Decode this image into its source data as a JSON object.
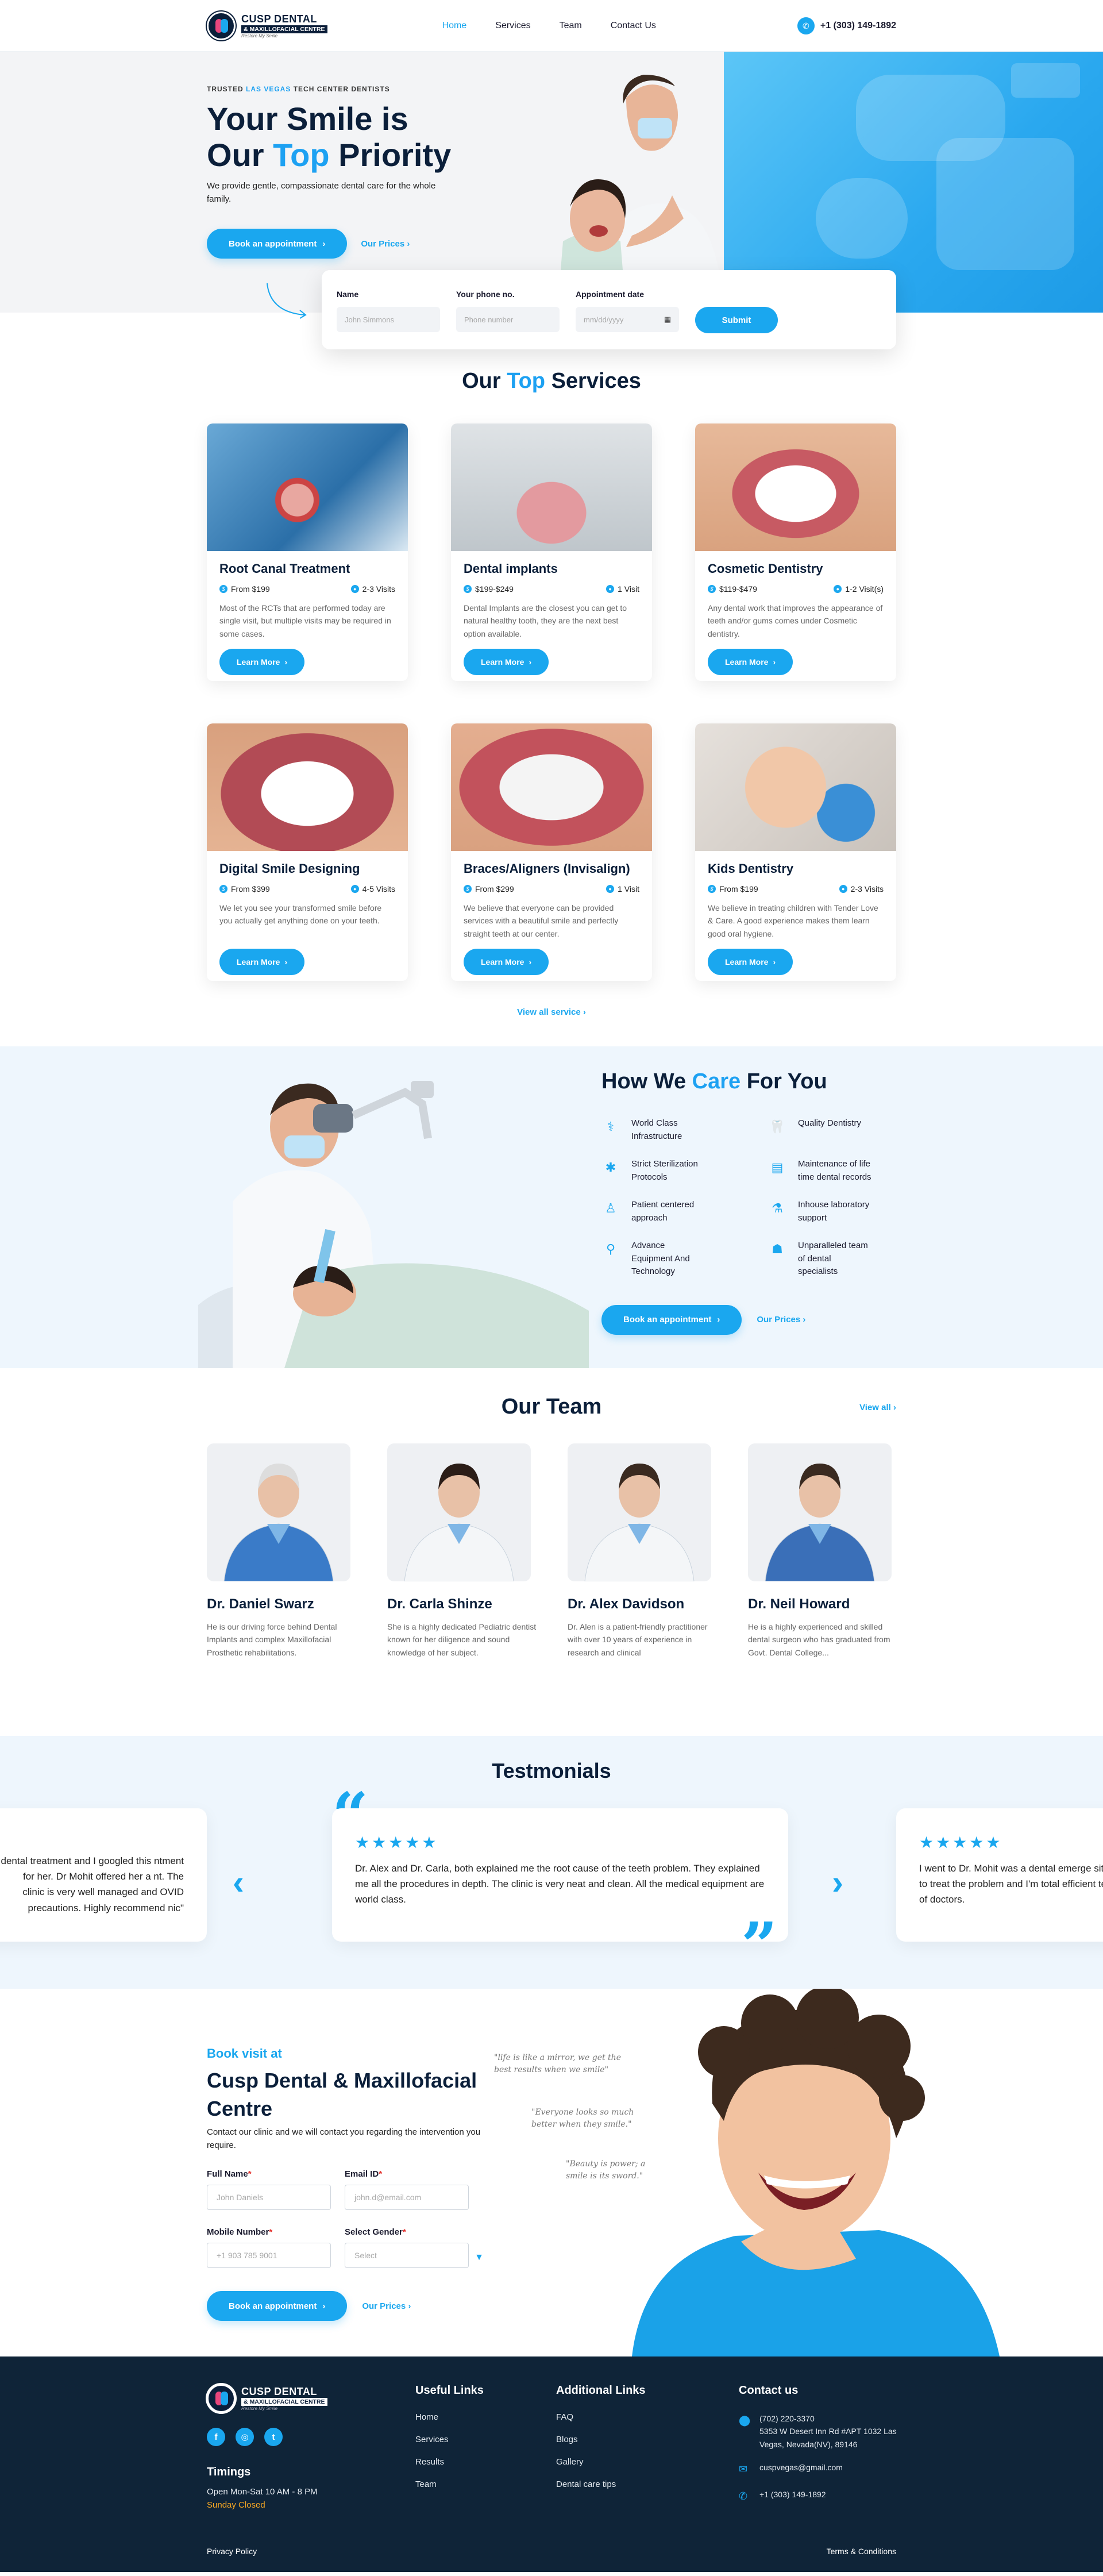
{
  "header": {
    "logo": {
      "line1": "CUSP DENTAL",
      "line2": "& MAXILLOFACIAL CENTRE",
      "line3": "Restore My Smile"
    },
    "nav": [
      "Home",
      "Services",
      "Team",
      "Contact Us"
    ],
    "phone": "+1 (303) 149-1892"
  },
  "hero": {
    "tag_pre": "TRUSTED ",
    "tag_highlight": "LAS VEGAS",
    "tag_post": " TECH CENTER DENTISTS",
    "title_line1": "Your Smile is",
    "title_our": "Our ",
    "title_top": "Top",
    "title_priority": " Priority",
    "desc": "We provide gentle, compassionate dental care for the whole family.",
    "cta_primary": "Book an appointment",
    "cta_secondary": "Our Prices"
  },
  "appointment_form": {
    "name_label": "Name",
    "name_placeholder": "John Simmons",
    "phone_label": "Your phone no.",
    "phone_placeholder": "Phone number",
    "date_label": "Appointment date",
    "date_placeholder": "mm/dd/yyyy",
    "submit": "Submit"
  },
  "services": {
    "title_pre": "Our ",
    "title_top": "Top",
    "title_post": " Services",
    "learn_more": "Learn More",
    "view_all": "View all service",
    "items": [
      {
        "title": "Root Canal Treatment",
        "price": "From $199",
        "visits": "2-3 Visits",
        "desc": "Most of the RCTs that are performed today are single visit, but multiple visits may be required in some cases."
      },
      {
        "title": "Dental implants",
        "price": "$199-$249",
        "visits": "1 Visit",
        "desc": "Dental Implants are the closest you can get to natural healthy tooth, they are the next best option available."
      },
      {
        "title": "Cosmetic Dentistry",
        "price": "$119-$479",
        "visits": "1-2 Visit(s)",
        "desc": "Any dental work that improves the appearance of teeth and/or gums comes under Cosmetic dentistry."
      },
      {
        "title": "Digital Smile Designing",
        "price": "From $399",
        "visits": "4-5 Visits",
        "desc": "We let you see your transformed smile before you actually get anything done on your teeth."
      },
      {
        "title": "Braces/Aligners (Invisalign)",
        "price": "From $299",
        "visits": "1 Visit",
        "desc": "We believe that everyone can be provided services with a beautiful smile and perfectly straight teeth at our center."
      },
      {
        "title": "Kids Dentistry",
        "price": "From $199",
        "visits": "2-3 Visits",
        "desc": "We believe in treating children with Tender Love & Care. A good experience makes them learn good oral hygiene."
      }
    ]
  },
  "care": {
    "title_pre": "How We ",
    "title_care": "Care",
    "title_post": " For You",
    "items": [
      {
        "icon": "tooth-tools-icon",
        "label": "World Class Infrastructure"
      },
      {
        "icon": "tooth-icon",
        "label": "Quality Dentistry"
      },
      {
        "icon": "virus-shield-icon",
        "label": "Strict Sterilization Protocols"
      },
      {
        "icon": "records-icon",
        "label": "Maintenance of life time dental records"
      },
      {
        "icon": "patient-icon",
        "label": "Patient centered approach"
      },
      {
        "icon": "lab-icon",
        "label": "Inhouse laboratory support"
      },
      {
        "icon": "equipment-icon",
        "label": "Advance Equipment And Technology"
      },
      {
        "icon": "specialist-icon",
        "label": "Unparalleled team of dental specialists"
      }
    ],
    "cta_primary": "Book an appointment",
    "cta_secondary": "Our Prices"
  },
  "team": {
    "title": "Our Team",
    "view_all": "View all",
    "members": [
      {
        "name": "Dr. Daniel Swarz",
        "desc": "He is our driving force behind Dental Implants and complex Maxillofacial Prosthetic rehabilitations."
      },
      {
        "name": "Dr. Carla Shinze",
        "desc": "She is a highly dedicated Pediatric dentist known for her diligence and sound knowledge of her subject."
      },
      {
        "name": "Dr. Alex Davidson",
        "desc": "Dr. Alen is a patient-friendly practitioner with over 10 years of experience in research and clinical"
      },
      {
        "name": "Dr. Neil Howard",
        "desc": "He is a highly experienced and skilled dental surgeon who has graduated from Govt. Dental College..."
      }
    ]
  },
  "testimonials": {
    "title": "Testmonials",
    "left": "dental treatment and I googled this ntment for her. Dr Mohit offered her a nt. The clinic is very well managed and OVID precautions. Highly recommend nic\"",
    "center": "Dr. Alex and Dr. Carla, both explained me the root cause of the teeth problem. They explained me all the procedures in depth. The clinic is very neat and clean. All the medical equipment are world class.",
    "right": "I went to Dr. Mohit was a dental emerge sitting to treat the problem and I'm total efficient team of doctors.",
    "stars": "★★★★★"
  },
  "booking": {
    "kicker": "Book visit at",
    "title": "Cusp Dental & Maxillofacial Centre",
    "desc": "Contact our clinic and we will contact you regarding the intervention you require.",
    "full_name_label": "Full Name",
    "full_name_placeholder": "John Daniels",
    "email_label": "Email ID",
    "email_placeholder": "john.d@email.com",
    "mobile_label": "Mobile Number",
    "mobile_placeholder": "+1 903 785 9001",
    "gender_label": "Select Gender",
    "gender_placeholder": "Select",
    "required_mark": "*",
    "cta_primary": "Book an appointment",
    "cta_secondary": "Our Prices",
    "quotes": [
      "\"life is like a mirror, we get the best results when we smile\"",
      "\"Everyone looks so much better when they smile.\"",
      "\"Beauty is power; a smile is its sword.\""
    ]
  },
  "footer": {
    "timings_title": "Timings",
    "timings_open": "Open Mon-Sat 10 AM - 8 PM",
    "timings_closed": "Sunday Closed",
    "useful_title": "Useful Links",
    "useful": [
      "Home",
      "Services",
      "Results",
      "Team"
    ],
    "additional_title": "Additional Links",
    "additional": [
      "FAQ",
      "Blogs",
      "Gallery",
      "Dental care tips"
    ],
    "contact_title": "Contact us",
    "contact_phone1": "(702) 220-3370",
    "contact_address": "5353 W Desert Inn Rd #APT 1032 Las Vegas, Nevada(NV), 89146",
    "contact_email": "cuspvegas@gmail.com",
    "contact_phone2": "+1 (303) 149-1892",
    "privacy": "Privacy Policy",
    "terms": "Terms & Conditions",
    "social": [
      "f",
      "◎",
      "t"
    ]
  }
}
